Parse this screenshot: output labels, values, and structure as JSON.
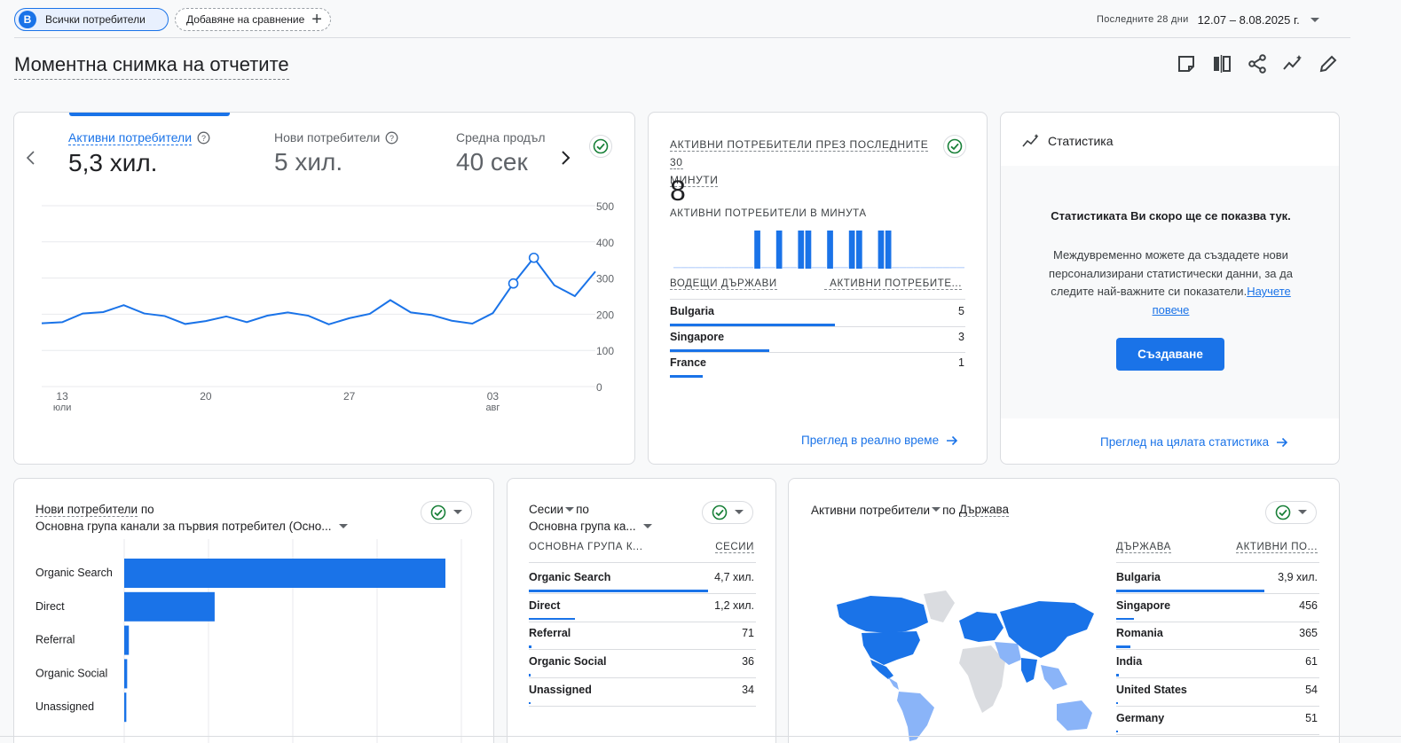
{
  "header": {
    "segment_letter": "B",
    "segment_label": "Всички потребители",
    "add_compare_label": "Добавяне на сравнение",
    "date_range_caption": "Последните 28 дни",
    "date_range_value": "12.07 – 8.08.2025 г."
  },
  "page": {
    "title": "Моментна снимка на отчетите"
  },
  "toolbar_icons": [
    "note-icon",
    "compare-columns-icon",
    "share-icon",
    "insights-icon",
    "edit-pencil-icon"
  ],
  "overview": {
    "tabs": [
      {
        "label": "Активни потребители",
        "value": "5,3 хил."
      },
      {
        "label": "Нови потребители",
        "value": "5 хил."
      },
      {
        "label": "Средна продъл",
        "value": "40 сек"
      }
    ],
    "y_ticks": [
      "500",
      "400",
      "300",
      "200",
      "100",
      "0"
    ],
    "x_ticks": [
      {
        "day": "13",
        "month": "юли"
      },
      {
        "day": "20",
        "month": ""
      },
      {
        "day": "27",
        "month": ""
      },
      {
        "day": "03",
        "month": "авг"
      }
    ],
    "chart_data": {
      "type": "line",
      "series": [
        {
          "name": "Активни потребители",
          "values": [
            175,
            178,
            202,
            206,
            225,
            202,
            195,
            173,
            181,
            194,
            178,
            196,
            205,
            196,
            172,
            189,
            201,
            239,
            205,
            198,
            182,
            174,
            203,
            285,
            356,
            280,
            250,
            318
          ]
        }
      ],
      "ylim": [
        0,
        500
      ]
    }
  },
  "realtime": {
    "title_line1": "АКТИВНИ ПОТРЕБИТЕЛИ ПРЕЗ ПОСЛЕДНИТЕ 30",
    "title_line2": "МИНУТИ",
    "value": "8",
    "per_minute_label": "АКТИВНИ ПОТРЕБИТЕЛИ В МИНУТА",
    "per_minute_values": [
      0,
      0,
      0,
      0,
      0,
      0,
      0,
      0,
      0,
      0,
      0,
      1,
      0,
      0,
      1,
      0,
      0,
      1,
      1,
      0,
      0,
      1,
      0,
      0,
      1,
      1,
      0,
      0,
      1,
      1,
      0,
      0,
      0,
      0,
      0,
      0,
      0,
      0,
      0,
      0
    ],
    "col_country": "ВОДЕЩИ ДЪРЖАВИ",
    "col_users": "АКТИВНИ ПОТРЕБИТЕ...",
    "rows": [
      {
        "name": "Bulgaria",
        "value": "5",
        "share": 1.0
      },
      {
        "name": "Singapore",
        "value": "3",
        "share": 0.6
      },
      {
        "name": "France",
        "value": "1",
        "share": 0.2
      }
    ],
    "link": "Преглед в реално време"
  },
  "insights": {
    "title": "Статистика",
    "heading": "Статистиката Ви скоро ще се показва тук.",
    "body_line1": "Междувременно можете да създадете нови",
    "body_line2": "персонализирани статистически данни, за да",
    "body_line3": "следите най-важните си показатели.",
    "learn_more_1": "Научете",
    "learn_more_2": "повече",
    "create_button": "Създаване",
    "link": "Преглед на цялата статистика"
  },
  "new_users": {
    "title": "Нови потребители",
    "by": "по",
    "dimension": "Основна група канали за първия потребител (Осно...",
    "chart_data": {
      "type": "bar",
      "categories": [
        "Organic Search",
        "Direct",
        "Referral",
        "Organic Social",
        "Unassigned"
      ],
      "values": [
        3800,
        1070,
        55,
        35,
        25
      ]
    }
  },
  "sessions": {
    "metric": "Сесии",
    "by": "по",
    "dimension": "Основна група ка...",
    "col_dim": "ОСНОВНА ГРУПА К...",
    "col_metric": "СЕСИИ",
    "rows": [
      {
        "name": "Organic Search",
        "value": "4,7 хил.",
        "share": 1.0
      },
      {
        "name": "Direct",
        "value": "1,2 хил.",
        "share": 0.255
      },
      {
        "name": "Referral",
        "value": "71",
        "share": 0.015
      },
      {
        "name": "Organic Social",
        "value": "36",
        "share": 0.008
      },
      {
        "name": "Unassigned",
        "value": "34",
        "share": 0.007
      }
    ]
  },
  "countries": {
    "metric": "Активни потребители",
    "by": "по",
    "dimension": "Държава",
    "col_dim": "ДЪРЖАВА",
    "col_metric": "АКТИВНИ ПО...",
    "rows": [
      {
        "name": "Bulgaria",
        "value": "3,9 хил.",
        "share": 1.0
      },
      {
        "name": "Singapore",
        "value": "456",
        "share": 0.117
      },
      {
        "name": "Romania",
        "value": "365",
        "share": 0.094
      },
      {
        "name": "India",
        "value": "61",
        "share": 0.016
      },
      {
        "name": "United States",
        "value": "54",
        "share": 0.014
      },
      {
        "name": "Germany",
        "value": "51",
        "share": 0.013
      }
    ]
  }
}
